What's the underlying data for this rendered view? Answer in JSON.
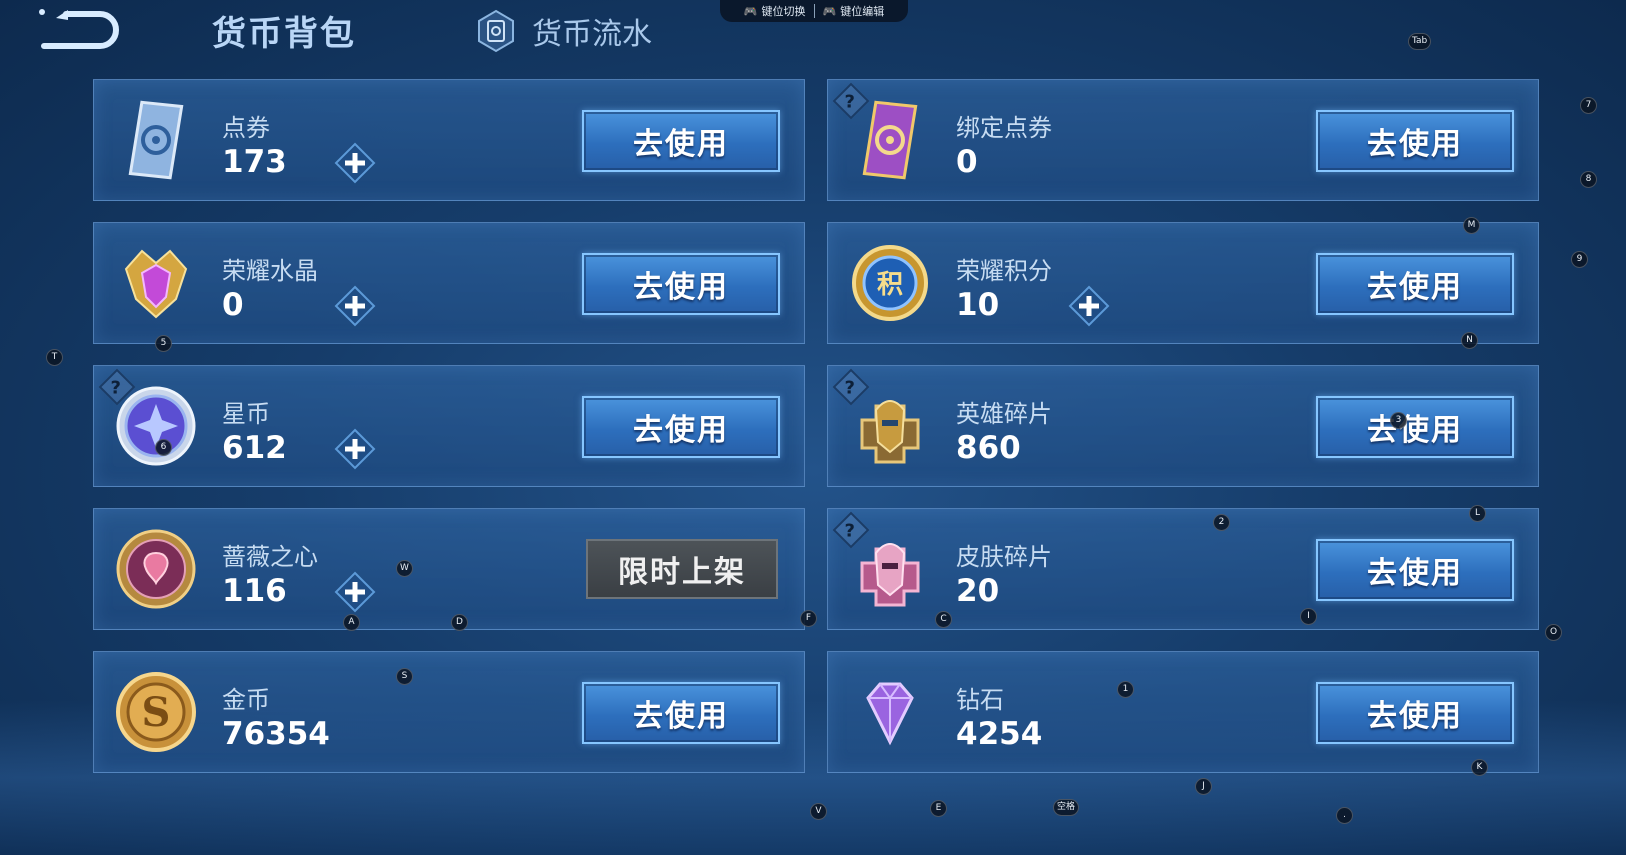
{
  "header": {
    "title": "货币背包",
    "flow_tab": "货币流水"
  },
  "keybar": {
    "switch_label": "键位切换",
    "edit_label": "键位编辑"
  },
  "cards": [
    {
      "name": "点券",
      "amount": "173",
      "button": "去使用",
      "icon": "coupon-card-icon"
    },
    {
      "name": "绑定点券",
      "amount": "0",
      "button": "去使用",
      "icon": "bound-coupon-card-icon"
    },
    {
      "name": "荣耀水晶",
      "amount": "0",
      "button": "去使用",
      "icon": "glory-crystal-icon"
    },
    {
      "name": "荣耀积分",
      "amount": "10",
      "button": "去使用",
      "icon": "glory-points-icon"
    },
    {
      "name": "星币",
      "amount": "612",
      "button": "去使用",
      "icon": "star-coin-icon"
    },
    {
      "name": "英雄碎片",
      "amount": "860",
      "button": "去使用",
      "icon": "hero-fragment-icon"
    },
    {
      "name": "蔷薇之心",
      "amount": "116",
      "button": "限时上架",
      "icon": "rose-heart-icon"
    },
    {
      "name": "皮肤碎片",
      "amount": "20",
      "button": "去使用",
      "icon": "skin-fragment-icon"
    },
    {
      "name": "金币",
      "amount": "76354",
      "button": "去使用",
      "icon": "gold-coin-icon"
    },
    {
      "name": "钻石",
      "amount": "4254",
      "button": "去使用",
      "icon": "diamond-icon"
    }
  ],
  "key_hints": [
    "Tab",
    "7",
    "8",
    "M",
    "9",
    "N",
    "T",
    "5",
    "6",
    "3",
    "2",
    "L",
    "W",
    "A",
    "D",
    "F",
    "C",
    "I",
    "O",
    "S",
    "1",
    "K",
    "J",
    "V",
    "E",
    "空格",
    "."
  ],
  "colors": {
    "accent": "#2d6fbd",
    "background": "#163d6b",
    "disabled": "#3a3f44"
  }
}
